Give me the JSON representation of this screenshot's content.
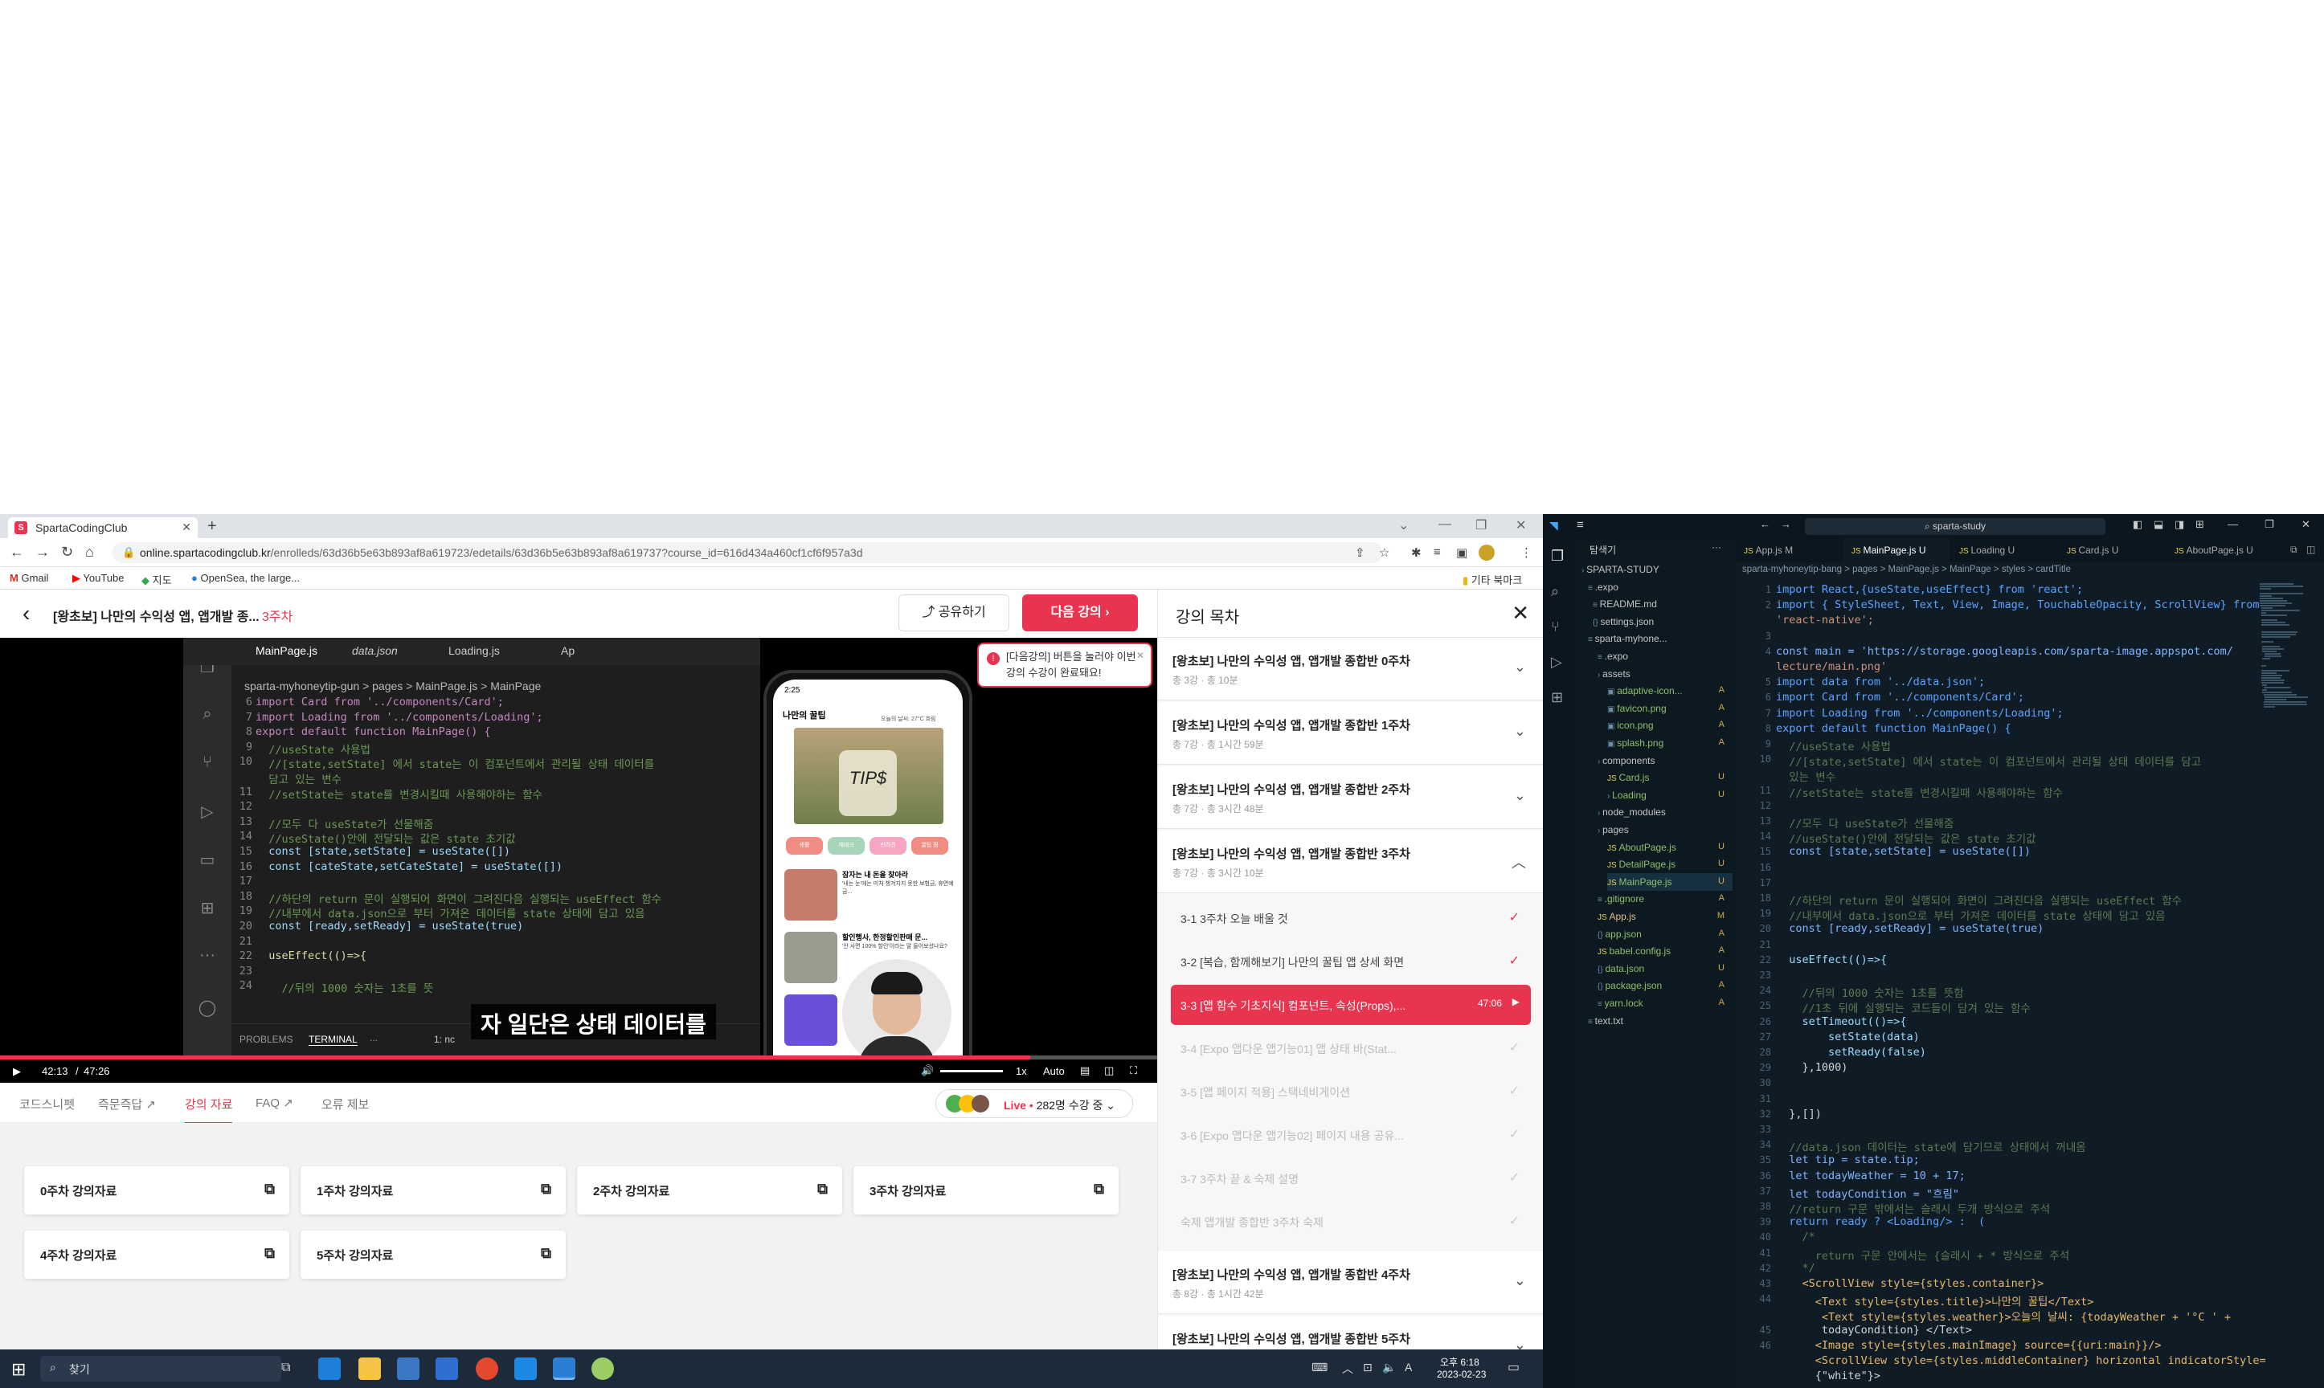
{
  "browser": {
    "tab_title": "SpartaCodingClub",
    "url_host": "online.spartacodingclub.kr",
    "url_path": "/enrolleds/63d36b5e63b893af8a619723/edetails/63d36b5e63b893af8a619737?course_id=616d434a460cf1cf6f957a3d",
    "bookmarks": [
      "Gmail",
      "YouTube",
      "지도",
      "OpenSea, the large..."
    ],
    "other_bookmarks": "기타 북마크"
  },
  "lecture": {
    "title": "[왕초보] 나만의 수익성 앱, 앱개발 종...",
    "week": "3주차",
    "share_label": "공유하기",
    "next_label": "다음 강의",
    "toast": "[다음강의] 버튼을 눌러야 이번 강의 수강이 완료돼요!",
    "video": {
      "subtitle": "자 일단은 상태 데이터를",
      "current_time": "42:13",
      "duration": "47:26",
      "speed": "1x",
      "quality": "Auto",
      "progress": 0.89,
      "inner_tabs": [
        "MainPage.js",
        "data.json",
        "Loading.js",
        "Ap"
      ],
      "inner_breadcrumb": "sparta-myhoneytip-gun > pages > MainPage.js > MainPage",
      "panel_tabs": [
        "PROBLEMS",
        "TERMINAL",
        "..."
      ],
      "panel_extra": "1: nc",
      "phone_title": "나만의 꿀팁",
      "phone_weather": "오늘의 날씨: 27°C 흐림",
      "phone_chips": [
        "생활",
        "재테크",
        "반려견",
        "꿀팁 찜"
      ],
      "phone_items": [
        {
          "title": "잠자는 내 돈을 찾아라",
          "desc": "'내는 눈'에는 미처 챙겨지지 못한 보험금, 휴면예금..."
        },
        {
          "title": "할인행사, 한정할인판매 문...",
          "desc": "'안 사면 100% 할인'이라는 말 들어보셨나요?"
        }
      ],
      "code_lines": [
        {
          "n": "6",
          "t": "import Card from '../components/Card';"
        },
        {
          "n": "7",
          "t": "import Loading from '../components/Loading';"
        },
        {
          "n": "8",
          "t": "export default function MainPage() {"
        },
        {
          "n": "9",
          "t": "  //useState 사용법"
        },
        {
          "n": "10",
          "t": "  //[state,setState] 에서 state는 이 컴포넌트에서 관리될 상태 데이터를"
        },
        {
          "n": "",
          "t": "  담고 있는 변수"
        },
        {
          "n": "11",
          "t": "  //setState는 state를 변경시킬때 사용해야하는 함수"
        },
        {
          "n": "12",
          "t": ""
        },
        {
          "n": "13",
          "t": "  //모두 다 useState가 선물해줌"
        },
        {
          "n": "14",
          "t": "  //useState()안에 전달되는 값은 state 초기값"
        },
        {
          "n": "15",
          "t": "  const [state,setState] = useState([])"
        },
        {
          "n": "16",
          "t": "  const [cateState,setCateState] = useState([])"
        },
        {
          "n": "17",
          "t": ""
        },
        {
          "n": "18",
          "t": "  //하단의 return 문이 실행되어 화면이 그려진다음 실행되는 useEffect 함수"
        },
        {
          "n": "19",
          "t": "  //내부에서 data.json으로 부터 가져온 데이터를 state 상태에 담고 있음"
        },
        {
          "n": "20",
          "t": "  const [ready,setReady] = useState(true)"
        },
        {
          "n": "21",
          "t": ""
        },
        {
          "n": "22",
          "t": "  useEffect(()=>{"
        },
        {
          "n": "23",
          "t": ""
        },
        {
          "n": "24",
          "t": "    //뒤의 1000 숫자는 1초를 뜻"
        }
      ]
    },
    "nav_tabs": [
      "코드스니펫",
      "즉문즉답",
      "강의 자료",
      "FAQ",
      "오류 제보"
    ],
    "live_label": "Live",
    "live_count": "282명 수강 중",
    "materials": [
      "0주차 강의자료",
      "1주차 강의자료",
      "2주차 강의자료",
      "3주차 강의자료",
      "4주차 강의자료",
      "5주차 강의자료"
    ]
  },
  "toc": {
    "title": "강의 목차",
    "weeks": [
      {
        "title": "[왕초보] 나만의 수익성 앱, 앱개발 종합반 0주차",
        "meta": "총 3강 · 총 10분"
      },
      {
        "title": "[왕초보] 나만의 수익성 앱, 앱개발 종합반 1주차",
        "meta": "총 7강 · 총 1시간 59분"
      },
      {
        "title": "[왕초보] 나만의 수익성 앱, 앱개발 종합반 2주차",
        "meta": "총 7강 · 총 3시간 48분"
      },
      {
        "title": "[왕초보] 나만의 수익성 앱, 앱개발 종합반 3주차",
        "meta": "총 7강 · 총 3시간 10분"
      }
    ],
    "lessons": [
      {
        "label": "3-1  3주차 오늘 배울 것",
        "state": "done"
      },
      {
        "label": "3-2  [복습, 함께해보기] 나만의 꿀팁 앱 상세 화면",
        "state": "done"
      },
      {
        "label": "3-3  [앱 함수 기초지식] 컴포넌트, 속성(Props),...",
        "state": "current",
        "time": "47:06"
      },
      {
        "label": "3-4  [Expo 앱다운 앱기능01] 앱 상태 바(Stat...",
        "state": "todo"
      },
      {
        "label": "3-5  [앱 페이지 적용] 스택네비게이션",
        "state": "todo"
      },
      {
        "label": "3-6  [Expo 앱다운 앱기능02] 페이지 내용 공유...",
        "state": "todo"
      },
      {
        "label": "3-7  3주차 끝 & 숙제 설명",
        "state": "todo"
      },
      {
        "label": "숙제  앱개발 종합반 3주차 숙제",
        "state": "todo"
      }
    ],
    "weeks_after": [
      {
        "title": "[왕초보] 나만의 수익성 앱, 앱개발 종합반 4주차",
        "meta": "총 8강 · 총 1시간 42분"
      },
      {
        "title": "[왕초보] 나만의 수익성 앱, 앱개발 종합반 5주차",
        "meta": ""
      }
    ]
  },
  "taskbar": {
    "search": "찾기",
    "time": "오후 6:18",
    "date": "2023-02-23",
    "ime": "A"
  },
  "vscode": {
    "search": "sparta-study",
    "explorer_title": "탐색기",
    "tabs": [
      "App.js  M",
      "MainPage.js  U",
      "Loading  U",
      "Card.js  U",
      "AboutPage.js  U"
    ],
    "breadcrumb": "sparta-myhoneytip-bang > pages > MainPage.js > MainPage > styles > cardTitle",
    "files": [
      {
        "name": "SPARTA-STUDY",
        "badge": ""
      },
      {
        "name": ".expo",
        "badge": ""
      },
      {
        "name": "README.md",
        "badge": ""
      },
      {
        "name": "settings.json",
        "badge": ""
      },
      {
        "name": "sparta-myhone...",
        "badge": ""
      },
      {
        "name": ".expo",
        "badge": ""
      },
      {
        "name": "assets",
        "badge": ""
      },
      {
        "name": "adaptive-icon...",
        "badge": "A"
      },
      {
        "name": "favicon.png",
        "badge": "A"
      },
      {
        "name": "icon.png",
        "badge": "A"
      },
      {
        "name": "splash.png",
        "badge": "A"
      },
      {
        "name": "components",
        "badge": ""
      },
      {
        "name": "Card.js",
        "badge": "U"
      },
      {
        "name": "Loading",
        "badge": "U"
      },
      {
        "name": "node_modules",
        "badge": ""
      },
      {
        "name": "pages",
        "badge": ""
      },
      {
        "name": "AboutPage.js",
        "badge": "U"
      },
      {
        "name": "DetailPage.js",
        "badge": "U"
      },
      {
        "name": "MainPage.js",
        "badge": "U"
      },
      {
        "name": ".gitignore",
        "badge": "A"
      },
      {
        "name": "App.js",
        "badge": "M"
      },
      {
        "name": "app.json",
        "badge": "A"
      },
      {
        "name": "babel.config.js",
        "badge": "A"
      },
      {
        "name": "data.json",
        "badge": "U"
      },
      {
        "name": "package.json",
        "badge": "A"
      },
      {
        "name": "yarn.lock",
        "badge": "A"
      },
      {
        "name": "text.txt",
        "badge": ""
      }
    ],
    "code": [
      "import React,{useState,useEffect} from 'react';",
      "import { StyleSheet, Text, View, Image, TouchableOpacity, ScrollView} from",
      "'react-native';",
      "",
      "const main = 'https://storage.googleapis.com/sparta-image.appspot.com/",
      "lecture/main.png'",
      "import data from '../data.json';",
      "import Card from '../components/Card';",
      "import Loading from '../components/Loading';",
      "export default function MainPage() {",
      "  //useState 사용법",
      "  //[state,setState] 에서 state는 이 컴포넌트에서 관리될 상태 데이터를 담고",
      "  있는 변수",
      "  //setState는 state를 변경시킬때 사용해야하는 함수",
      "",
      "  //모두 다 useState가 선물해줌",
      "  //useState()안에 전달되는 값은 state 초기값",
      "  const [state,setState] = useState([])",
      "",
      "",
      "  //하단의 return 문이 실행되어 화면이 그려진다음 실행되는 useEffect 함수",
      "  //내부에서 data.json으로 부터 가져온 데이터를 state 상태에 담고 있음",
      "  const [ready,setReady] = useState(true)",
      "",
      "  useEffect(()=>{",
      "",
      "    //뒤의 1000 숫자는 1초를 뜻함",
      "    //1초 뒤에 실행되는 코드들이 담겨 있는 함수",
      "    setTimeout(()=>{",
      "        setState(data)",
      "        setReady(false)",
      "    },1000)",
      "",
      "",
      "  },[])",
      "",
      "  //data.json 데이터는 state에 담기므로 상태에서 꺼내옴",
      "  let tip = state.tip;",
      "  let todayWeather = 10 + 17;",
      "  let todayCondition = \"흐림\"",
      "  //return 구문 밖에서는 슬래시 두개 방식으로 주석",
      "  return ready ? <Loading/> :  (",
      "    /*",
      "      return 구문 안에서는 {슬래시 + * 방식으로 주석",
      "    */",
      "    <ScrollView style={styles.container}>",
      "      <Text style={styles.title}>나만의 꿀팁</Text>",
      "       <Text style={styles.weather}>오늘의 날씨: {todayWeather + '°C ' +",
      "       todayCondition} </Text>",
      "      <Image style={styles.mainImage} source={{uri:main}}/>",
      "      <ScrollView style={styles.middleContainer} horizontal indicatorStyle=",
      "      {\"white\"}>"
    ],
    "line_numbers": [
      "1",
      "2",
      "",
      "3",
      "4",
      "",
      "5",
      "6",
      "7",
      "8",
      "9",
      "10",
      "",
      "11",
      "12",
      "13",
      "14",
      "15",
      "16",
      "17",
      "18",
      "19",
      "20",
      "21",
      "22",
      "23",
      "24",
      "25",
      "26",
      "27",
      "28",
      "29",
      "30",
      "31",
      "32",
      "33",
      "34",
      "35",
      "36",
      "37",
      "38",
      "39",
      "40",
      "41",
      "42",
      "43",
      "44",
      "",
      "45",
      "46",
      ""
    ]
  }
}
